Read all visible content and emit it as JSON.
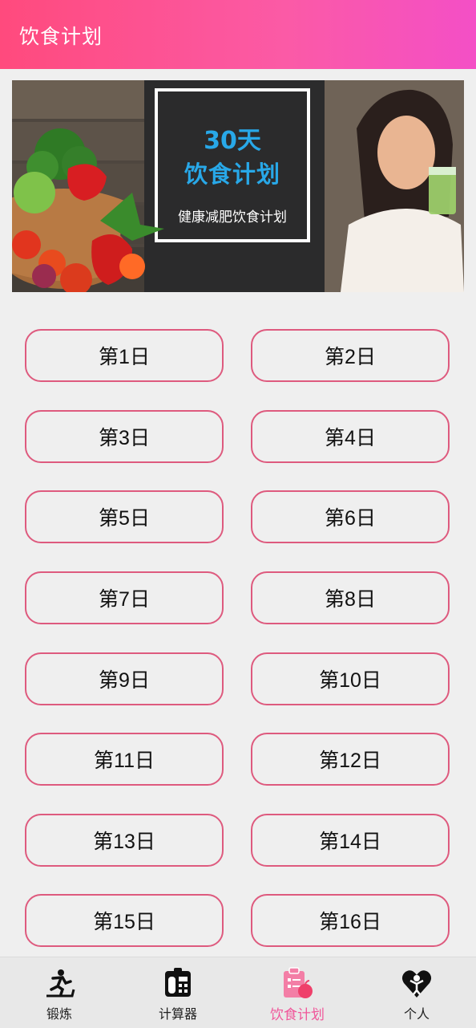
{
  "header": {
    "title": "饮食计划"
  },
  "banner": {
    "line1": "30天",
    "line2": "饮食计划",
    "subtitle": "健康减肥饮食计划"
  },
  "days": [
    "第1日",
    "第2日",
    "第3日",
    "第4日",
    "第5日",
    "第6日",
    "第7日",
    "第8日",
    "第9日",
    "第10日",
    "第11日",
    "第12日",
    "第13日",
    "第14日",
    "第15日",
    "第16日"
  ],
  "nav": {
    "items": [
      {
        "label": "锻炼",
        "icon": "running-treadmill-icon"
      },
      {
        "label": "计算器",
        "icon": "calculator-icon"
      },
      {
        "label": "饮食计划",
        "icon": "diet-plan-icon",
        "active": true
      },
      {
        "label": "个人",
        "icon": "person-heart-icon"
      }
    ],
    "active_color": "#f0579a"
  },
  "colors": {
    "header_start": "#ff4a7d",
    "header_end": "#f44fc6",
    "button_border": "#de5a7e",
    "banner_text": "#28a8e8"
  }
}
